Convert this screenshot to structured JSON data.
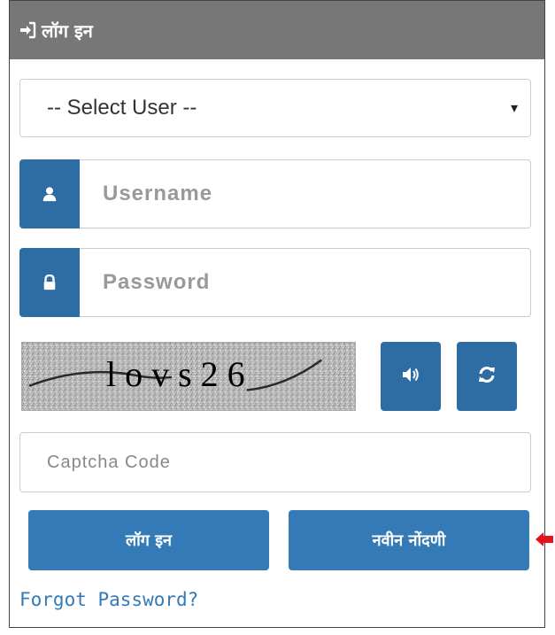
{
  "header": {
    "icon": "sign-in-icon",
    "title": "लॉग इन"
  },
  "form": {
    "select_user": {
      "selected": "-- Select User --",
      "caret": "▾"
    },
    "username": {
      "placeholder": "Username",
      "icon": "user-icon"
    },
    "password": {
      "placeholder": "Password",
      "icon": "lock-icon"
    },
    "captcha": {
      "text": "lovs26",
      "audio_icon": "volume-icon",
      "refresh_icon": "refresh-icon"
    },
    "captcha_code": {
      "placeholder": "Captcha Code"
    },
    "login_button": "लॉग इन",
    "register_button": "नवीन नोंदणी",
    "forgot_link": "Forgot Password?"
  },
  "colors": {
    "primary": "#337ab7",
    "addon": "#2e6da4",
    "header_bg": "#777777",
    "arrow": "#e8111a"
  }
}
